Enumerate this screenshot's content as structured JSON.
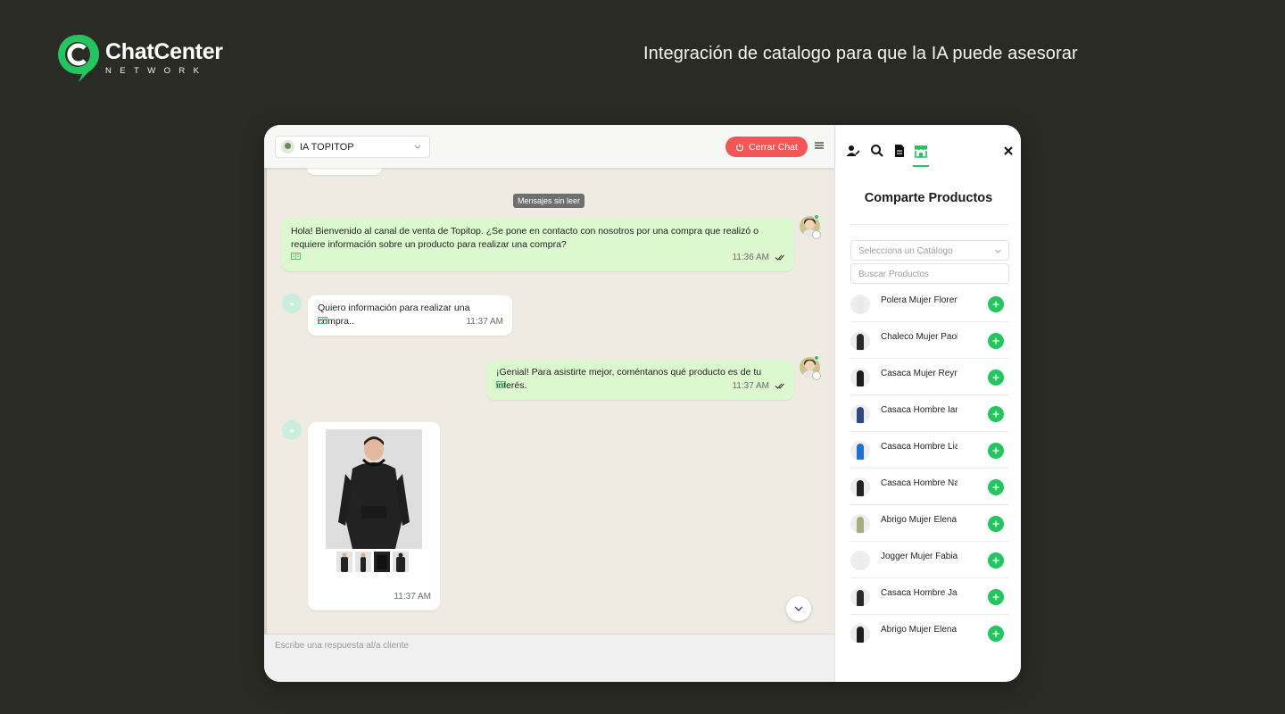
{
  "brand": {
    "name": "ChatCenter",
    "sub": "NETWORK",
    "color": "#22c55e"
  },
  "tagline": "Integración de catalogo para que la IA puede asesorar",
  "chat": {
    "agent_name": "IA TOPITOP",
    "close_chat_label": "Cerrar Chat",
    "unread_label": "Mensajes sin leer",
    "composer_placeholder": "Escribe una respuesta al/a cliente",
    "messages": [
      {
        "dir": "out",
        "text": "Hola! Bienvenido al canal de venta de Topitop. ¿Se pone en contacto con nosotros por una compra que realizó o requiere información sobre un producto para realizar una compra?",
        "time": "11:36 AM"
      },
      {
        "dir": "in",
        "text": "Quiero información para realizar una compra..",
        "time": "11:37 AM"
      },
      {
        "dir": "out",
        "text": "¡Genial! Para asistirte mejor, coméntanos qué producto es de tu interés.",
        "time": "11:37 AM"
      },
      {
        "dir": "in",
        "text": "",
        "time": "11:37 AM"
      }
    ],
    "colors": {
      "outgoing_bubble": "#dbf8cf",
      "background": "#efeae2",
      "close_button": "#f25657"
    }
  },
  "panel": {
    "title": "Comparte Productos",
    "catalog_placeholder": "Selecciona un Catálogo",
    "search_placeholder": "Buscar Productos",
    "products": [
      {
        "name": "Polera Mujer Florencia",
        "garment": "#e9e9e9"
      },
      {
        "name": "Chaleco Mujer Paola",
        "garment": "#2a2a2a"
      },
      {
        "name": "Casaca Mujer Reyna",
        "garment": "#1b1b1b"
      },
      {
        "name": "Casaca Hombre Ian",
        "garment": "#2c4a7a"
      },
      {
        "name": "Casaca Hombre Liam",
        "garment": "#1f6fd1"
      },
      {
        "name": "Casaca Hombre Nathan",
        "garment": "#222222"
      },
      {
        "name": "Abrigo Mujer Elena",
        "garment": "#a6ad7e"
      },
      {
        "name": "Jogger Mujer Fabiana",
        "garment": "#ececec"
      },
      {
        "name": "Casaca Hombre Jack",
        "garment": "#2b2b2b"
      },
      {
        "name": "Abrigo Mujer Elena",
        "garment": "#1e1e1e"
      }
    ]
  }
}
